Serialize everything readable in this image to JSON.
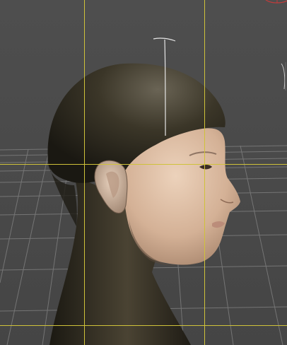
{
  "viewport": {
    "mode": "3D viewport",
    "subject": "human-head-model",
    "view": "side-profile"
  },
  "colors": {
    "background": "#4b4b4b",
    "grid": "#7a7a7a",
    "guide": "#cfc23a",
    "skin": "#d9b79a",
    "cap": "#2c281f",
    "gizmo": "#c33b3b"
  }
}
